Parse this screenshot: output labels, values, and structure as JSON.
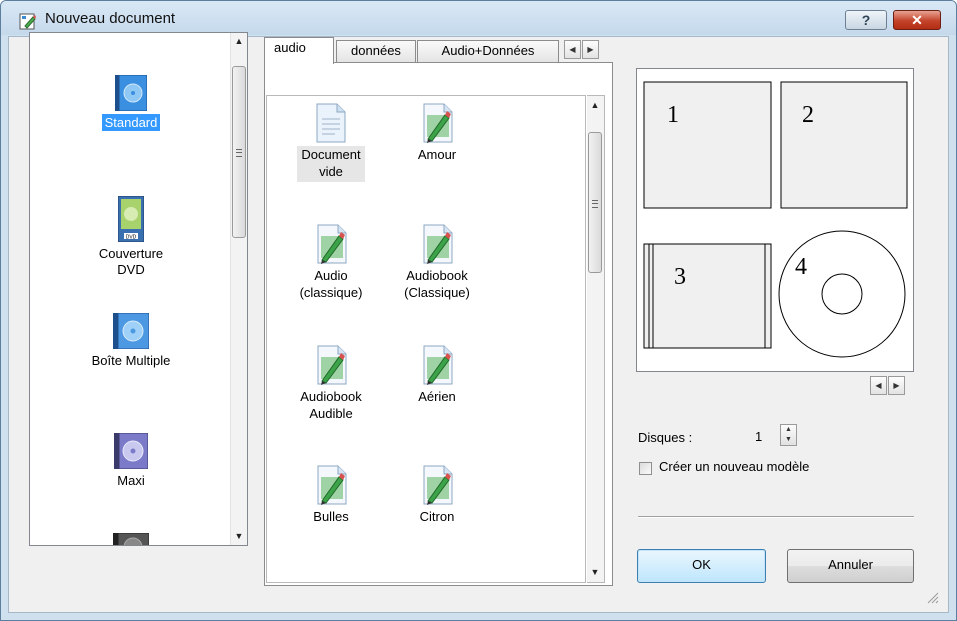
{
  "window": {
    "title": "Nouveau document",
    "help_label": "?",
    "close_label": "✕"
  },
  "left_list": {
    "selected_index": 0,
    "items": [
      {
        "label": "Standard",
        "icon": "standard-case-icon"
      },
      {
        "label": "Couverture\nDVD",
        "icon": "dvd-cover-icon"
      },
      {
        "label": "Boîte Multiple",
        "icon": "multi-box-icon"
      },
      {
        "label": "Maxi",
        "icon": "maxi-case-icon"
      }
    ]
  },
  "tabs": {
    "active": "audio",
    "items": [
      "audio",
      "données",
      "Audio+Données"
    ]
  },
  "templates": {
    "items": [
      {
        "label": "Document\nvide",
        "icon": "blank-document-icon"
      },
      {
        "label": "Amour",
        "icon": "template-edit-icon"
      },
      {
        "label": "Audio\n(classique)",
        "icon": "template-edit-icon"
      },
      {
        "label": "Audiobook\n(Classique)",
        "icon": "template-edit-icon"
      },
      {
        "label": "Audiobook\nAudible",
        "icon": "template-edit-icon"
      },
      {
        "label": "Aérien",
        "icon": "template-edit-icon"
      },
      {
        "label": "Bulles",
        "icon": "template-edit-icon"
      },
      {
        "label": "Citron",
        "icon": "template-edit-icon"
      }
    ]
  },
  "preview": {
    "labels": [
      "1",
      "2",
      "3",
      "4"
    ]
  },
  "options": {
    "disques_label": "Disques :",
    "disques_value": "1",
    "new_template_label": "Créer un nouveau modèle",
    "new_template_checked": false
  },
  "buttons": {
    "ok": "OK",
    "cancel": "Annuler"
  },
  "colors": {
    "selection": "#3399ff",
    "title_bar": "#c5d9ec",
    "close_button": "#c3432a"
  }
}
